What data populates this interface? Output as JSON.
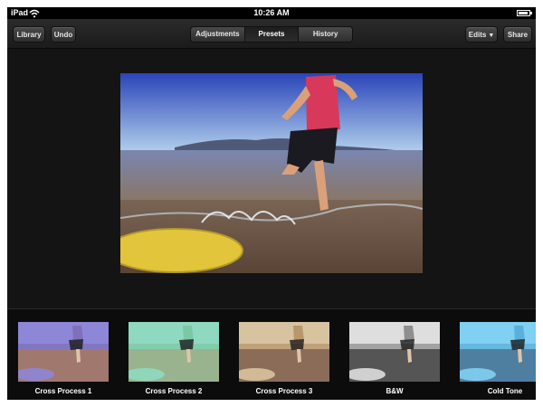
{
  "status_bar": {
    "carrier": "iPad",
    "time": "10:26 AM",
    "battery_level": 0.9
  },
  "toolbar": {
    "library_label": "Library",
    "undo_label": "Undo",
    "segments": [
      {
        "label": "Adjustments",
        "active": false
      },
      {
        "label": "Presets",
        "active": true
      },
      {
        "label": "History",
        "active": false
      }
    ],
    "edits_label": "Edits",
    "share_label": "Share"
  },
  "presets": [
    {
      "label": "Cross Process 1",
      "tint": "#7f6fb8",
      "sky": "#8e86d6",
      "ground": "#a0786e"
    },
    {
      "label": "Cross Process 2",
      "tint": "#7cc7a2",
      "sky": "#8fd9c0",
      "ground": "#98b38e"
    },
    {
      "label": "Cross Process 3",
      "tint": "#b7946a",
      "sky": "#d8c3a0",
      "ground": "#8a6c58"
    },
    {
      "label": "B&W",
      "tint": "#8a8a8a",
      "sky": "#dedede",
      "ground": "#555555"
    },
    {
      "label": "Cold Tone",
      "tint": "#5aaed8",
      "sky": "#7fd0f2",
      "ground": "#4f7fa0"
    }
  ],
  "icons": {
    "wifi": "wifi-icon",
    "battery": "battery-icon",
    "edits_caret": "caret-down-icon"
  }
}
